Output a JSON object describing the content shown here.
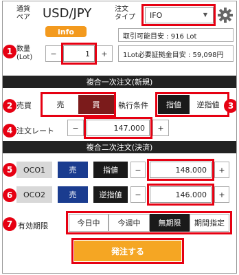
{
  "header": {
    "pair_label": "通貨\nペア",
    "pair": "USD/JPY",
    "info_button": "info",
    "order_type_label": "注文\nタイプ",
    "order_type_value": "IFO"
  },
  "quantity": {
    "label": "数量\n(Lot)",
    "minus": "−",
    "plus": "+",
    "value": "1",
    "available": "取引可能目安 : 916 Lot",
    "margin": "1Lot必要証拠金目安 : 59,098円"
  },
  "section1": {
    "title": "複合一次注文(新規)",
    "side_label": "売買",
    "sell": "売",
    "buy": "買",
    "exec_label": "執行条件",
    "limit": "指値",
    "stop": "逆指値",
    "rate_label": "注文レート",
    "rate_value": "147.000",
    "minus": "−",
    "plus": "+"
  },
  "section2": {
    "title": "複合二次注文(決済)",
    "oco1": {
      "label": "OCO1",
      "side": "売",
      "type": "指値",
      "minus": "−",
      "plus": "+",
      "value": "148.000"
    },
    "oco2": {
      "label": "OCO2",
      "side": "売",
      "type": "逆指値",
      "minus": "−",
      "plus": "+",
      "value": "146.000"
    },
    "expiry_label": "有効期限",
    "expiry_options": [
      "今日中",
      "今週中",
      "無期限",
      "期間指定"
    ]
  },
  "submit": "発注する",
  "markers": [
    "1",
    "2",
    "3",
    "4",
    "5",
    "6",
    "7"
  ],
  "icons": {
    "settings": "gear-icon",
    "dropdown": "chevron-down-icon"
  },
  "colors": {
    "accent_red": "#e60012",
    "info_orange": "#f39a1e",
    "submit_orange": "#f5a623",
    "buy_red": "#7b1b1b",
    "oco_blue": "#1a3c8f"
  }
}
